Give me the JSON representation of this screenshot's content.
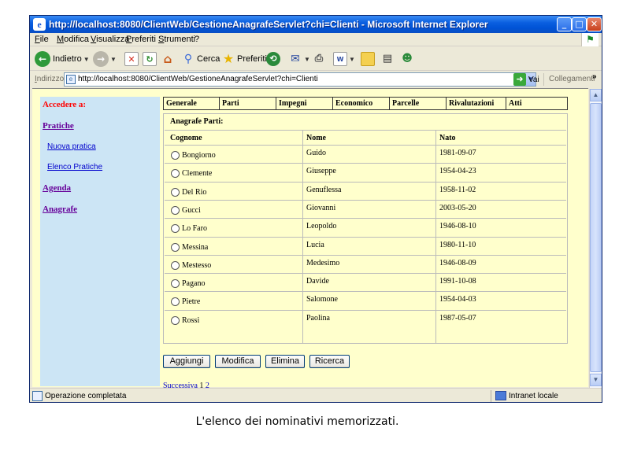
{
  "window": {
    "title": "http://localhost:8080/ClientWeb/GestioneAnagrafeServlet?chi=Clienti - Microsoft Internet Explorer"
  },
  "menubar": {
    "items": [
      "File",
      "Modifica",
      "Visualizza",
      "Preferiti",
      "Strumenti",
      "?"
    ]
  },
  "toolbar": {
    "back_label": "Indietro",
    "search_label": "Cerca",
    "favorites_label": "Preferiti"
  },
  "addressbar": {
    "label": "Indirizzo",
    "url": "http://localhost:8080/ClientWeb/GestioneAnagrafeServlet?chi=Clienti",
    "go_label": "Vai",
    "links_label": "Collegamenti"
  },
  "sidebar": {
    "title": "Accedere a:",
    "pratiche": "Pratiche",
    "nuova_pratica": "Nuova pratica",
    "elenco_pratiche": "Elenco Pratiche",
    "agenda": "Agenda",
    "anagrafe": "Anagrafe"
  },
  "tabs": [
    "Generale",
    "Parti",
    "Impegni",
    "Economico",
    "Parcelle",
    "Rivalutazioni",
    "Atti"
  ],
  "grid": {
    "title": "Anagrafe Parti:",
    "columns": [
      "Cognome",
      "Nome",
      "Nato"
    ],
    "rows": [
      {
        "cognome": "Bongiorno",
        "nome": "Guido",
        "nato": "1981-09-07"
      },
      {
        "cognome": "Clemente",
        "nome": "Giuseppe",
        "nato": "1954-04-23"
      },
      {
        "cognome": "Del Rio",
        "nome": "Genuflessa",
        "nato": "1958-11-02"
      },
      {
        "cognome": "Gucci",
        "nome": "Giovanni",
        "nato": "2003-05-20"
      },
      {
        "cognome": "Lo Faro",
        "nome": "Leopoldo",
        "nato": "1946-08-10"
      },
      {
        "cognome": "Messina",
        "nome": "Lucia",
        "nato": "1980-11-10"
      },
      {
        "cognome": "Mestesso",
        "nome": "Medesimo",
        "nato": "1946-08-09"
      },
      {
        "cognome": "Pagano",
        "nome": "Davide",
        "nato": "1991-10-08"
      },
      {
        "cognome": "Pietre",
        "nome": "Salomone",
        "nato": "1954-04-03"
      },
      {
        "cognome": "Rossi",
        "nome": "Paolina",
        "nato": "1987-05-07"
      }
    ]
  },
  "buttons": {
    "aggiungi": "Aggiungi",
    "modifica": "Modifica",
    "elimina": "Elimina",
    "ricerca": "Ricerca"
  },
  "pager": {
    "next_label": "Successiva",
    "current_page": "1",
    "page_2": "2"
  },
  "statusbar": {
    "text": "Operazione completata",
    "zone": "Intranet locale"
  },
  "caption": "L'elenco dei nominativi memorizzati.",
  "colors": {
    "content_bg": "#ffffcc",
    "sidebar_bg": "#cce5f5",
    "sidebar_title": "#ff0000",
    "sidebar_link": "#660099",
    "titlebar": "#0053d6"
  }
}
